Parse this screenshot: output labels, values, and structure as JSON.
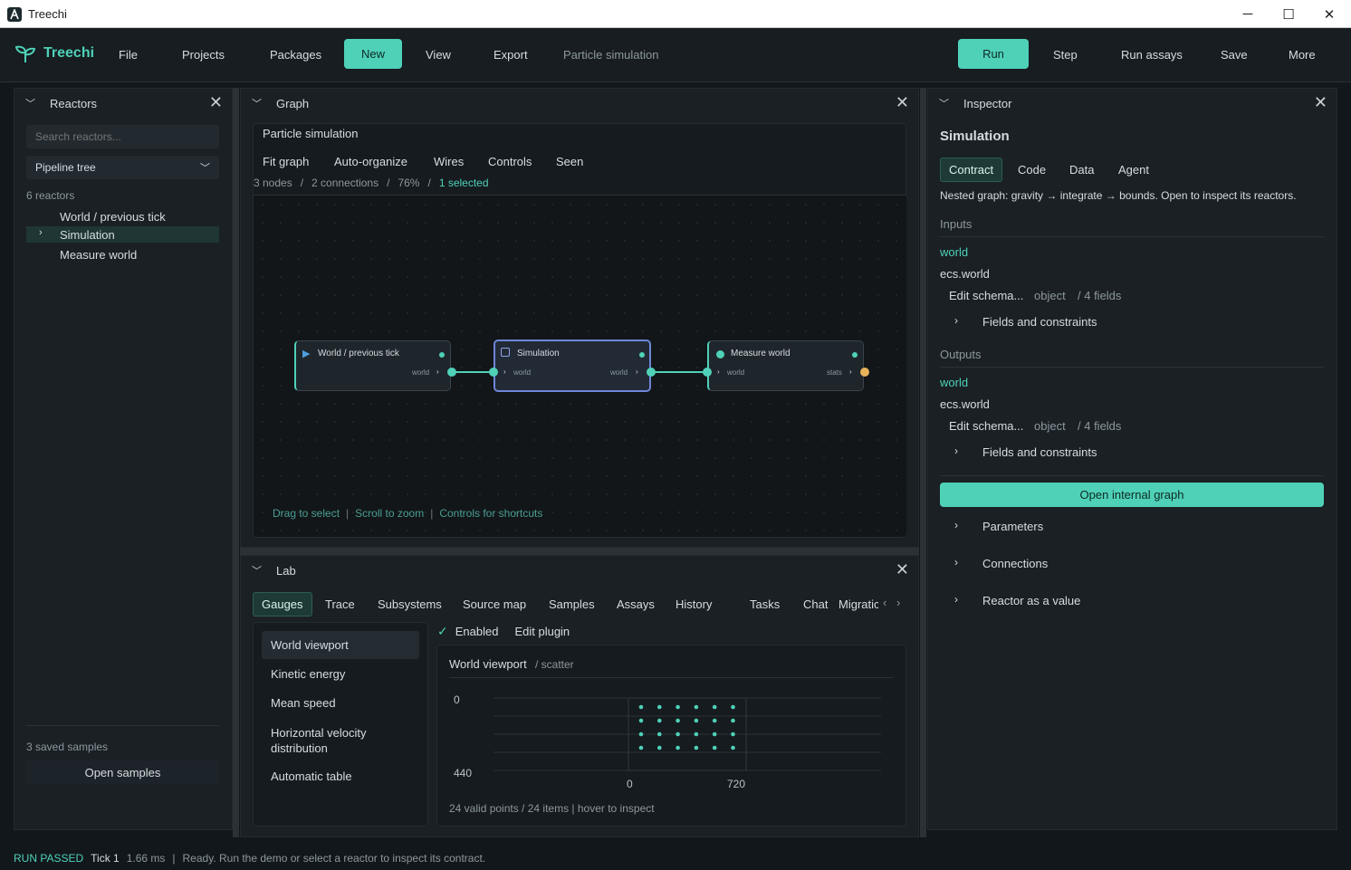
{
  "window": {
    "title": "Treechi",
    "min": "─",
    "max": "☐",
    "close": "✕"
  },
  "menubar": {
    "brand": "Treechi",
    "items": [
      "File",
      "Projects",
      "Packages",
      "New",
      "View",
      "Export"
    ],
    "breadcrumb": "Particle simulation",
    "actions": [
      "Run",
      "Step",
      "Run assays",
      "Save",
      "More"
    ]
  },
  "reactors": {
    "title": "Reactors",
    "search_placeholder": "Search reactors...",
    "view_select": "Pipeline tree",
    "count": "6 reactors",
    "items": [
      "World / previous tick",
      "Simulation",
      "Measure world"
    ],
    "saved": "3 saved samples",
    "open_samples": "Open samples"
  },
  "graph": {
    "title": "Graph",
    "name": "Particle simulation",
    "toolbar": [
      "Fit graph",
      "Auto-organize",
      "Wires",
      "Controls",
      "Seen"
    ],
    "stats": {
      "nodes": "3 nodes",
      "sep1": "/",
      "connections": "2 connections",
      "sep2": "/",
      "zoom": "76%",
      "sep3": "/",
      "selected": "1 selected"
    },
    "nodes": [
      {
        "title": "World / previous tick",
        "out": "world"
      },
      {
        "title": "Simulation",
        "in": "world",
        "out": "world"
      },
      {
        "title": "Measure world",
        "in": "world",
        "out": "stats"
      }
    ],
    "hints": [
      "Drag to select",
      "|",
      "Scroll to zoom",
      "|",
      "Controls for shortcuts"
    ]
  },
  "lab": {
    "title": "Lab",
    "tabs": [
      "Gauges",
      "Trace",
      "Subsystems",
      "Source map",
      "Samples",
      "Assays",
      "History",
      "Tasks",
      "Chat",
      "Migratic"
    ],
    "gauges": [
      "World viewport",
      "Kinetic energy",
      "Mean speed",
      "Horizontal velocity distribution",
      "Automatic table"
    ],
    "enabled": "Enabled",
    "edit_plugin": "Edit plugin",
    "viewport_title": "World viewport",
    "viewport_type": "/ scatter",
    "footer": "24 valid points / 24 items | hover to inspect"
  },
  "chart_data": {
    "type": "scatter",
    "title": "World viewport",
    "y_ticks": [
      "0",
      "440"
    ],
    "x_ticks": [
      "0",
      "720"
    ],
    "points_rows": 4,
    "points_cols": 6
  },
  "inspector": {
    "title": "Inspector",
    "heading": "Simulation",
    "tabs": [
      "Contract",
      "Code",
      "Data",
      "Agent"
    ],
    "description": "Nested graph: gravity → integrate → bounds. Open to inspect its reactors.",
    "inputs_label": "Inputs",
    "outputs_label": "Outputs",
    "input": {
      "name": "world",
      "type": "ecs.world",
      "edit": "Edit schema...",
      "kind": "object",
      "fields": "/ 4 fields",
      "constraints": "Fields and constraints"
    },
    "output": {
      "name": "world",
      "type": "ecs.world",
      "edit": "Edit schema...",
      "kind": "object",
      "fields": "/ 4 fields",
      "constraints": "Fields and constraints"
    },
    "open_graph": "Open internal graph",
    "sections": [
      "Parameters",
      "Connections",
      "Reactor as a value"
    ]
  },
  "status": {
    "state": "RUN PASSED",
    "tick": "Tick 1",
    "time": "1.66 ms",
    "sep": "|",
    "message": "Ready. Run the demo or select a reactor to inspect its contract."
  },
  "colors": {
    "accent": "#4fd1b8",
    "selection": "#6e86d8",
    "orange": "#e8b35a"
  }
}
